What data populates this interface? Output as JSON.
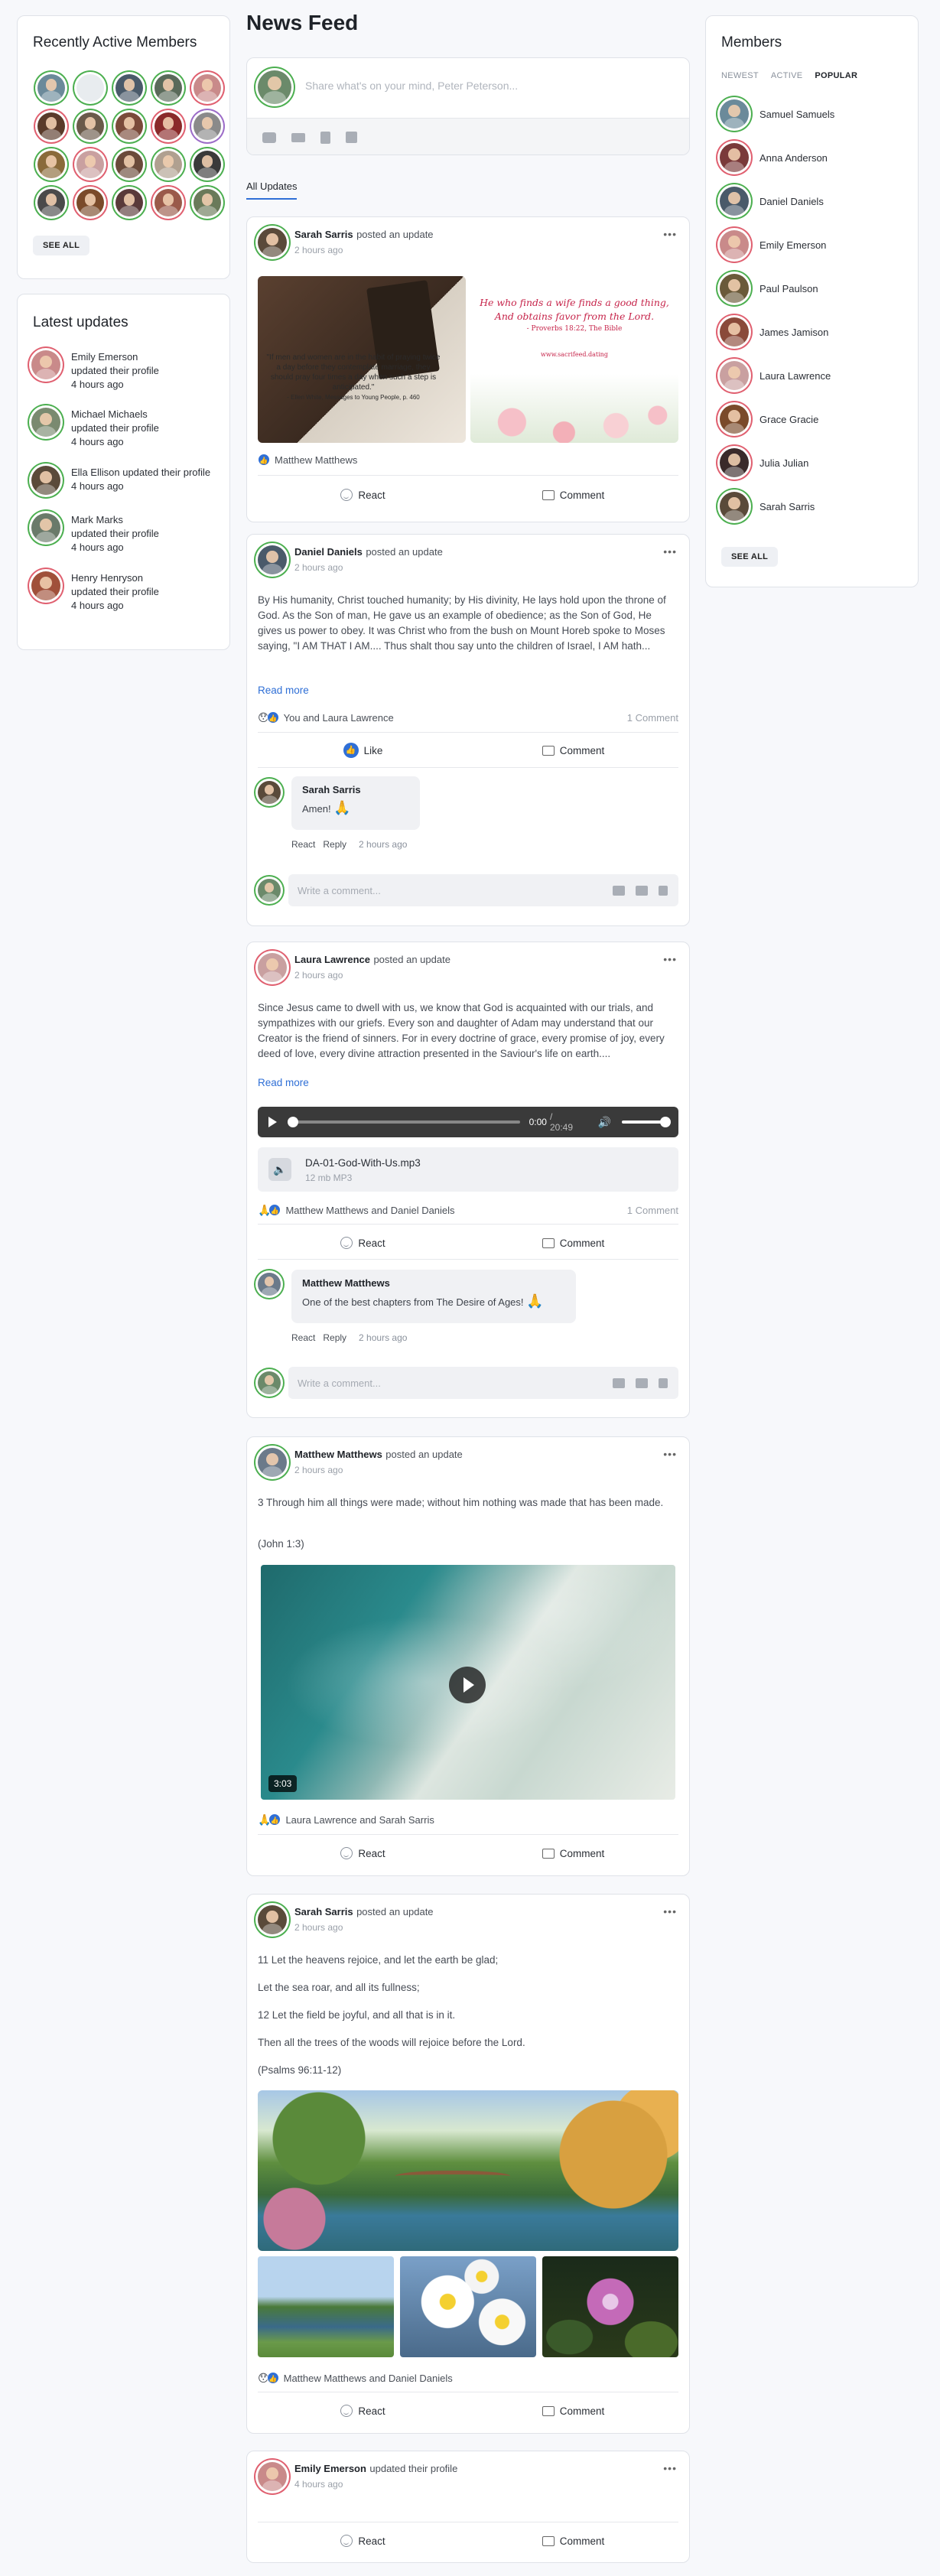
{
  "left": {
    "recent_title": "Recently Active Members",
    "see_all": "SEE ALL",
    "latest_title": "Latest updates",
    "updates": [
      {
        "name": "Emily Emerson",
        "action": "updated their profile",
        "time": "4 hours ago",
        "color": "#c98a8a"
      },
      {
        "name": "Michael Michaels",
        "action": "updated their profile",
        "time": "4 hours ago",
        "color": "#7a8a70"
      },
      {
        "name": "Ella Ellison",
        "action": "updated their profile",
        "time": "4 hours ago",
        "color": "#5a4a3a"
      },
      {
        "name": "Mark Marks",
        "action": "updated their profile",
        "time": "4 hours ago",
        "color": "#6a7a6a"
      },
      {
        "name": "Henry Henryson",
        "action": "updated their profile",
        "time": "4 hours ago",
        "color": "#a0503a"
      }
    ]
  },
  "feed": {
    "title": "News Feed",
    "composer_placeholder": "Share what's on your mind, Peter Peterson...",
    "tab_all": "All Updates",
    "react": "React",
    "comment": "Comment",
    "like": "Like",
    "read_more": "Read more",
    "write_comment": "Write a comment...",
    "reply": "Reply",
    "posts": [
      {
        "name": "Sarah Sarris",
        "action": "posted an update",
        "time": "2 hours ago",
        "image_quote": "\"If men and women are in the habit of praying twice a day before they contemplate marriage, they should pray four times a day when such a step is anticipated.\"",
        "image_credit": "- Ellen White, Messages to Young People, p. 460",
        "verse_line1": "He who finds a wife finds a good thing,",
        "verse_line2": "And obtains favor from the Lord.",
        "verse_ref": "- Proverbs 18:22, The Bible",
        "verse_site": "www.sacrifeed.dating",
        "reactions": "Matthew Matthews"
      },
      {
        "name": "Daniel Daniels",
        "action": "posted an update",
        "time": "2 hours ago",
        "text": "By His humanity, Christ touched humanity; by His divinity, He lays hold upon the throne of God. As the Son of man, He gave us an example of obedience; as the Son of God, He gives us power to obey. It was Christ who from the bush on Mount Horeb spoke to Moses saying, \"I AM THAT I AM.... Thus shalt thou say unto the children of Israel, I AM hath...",
        "reactions": "You and Laura Lawrence",
        "comment_count": "1 Comment",
        "c_name": "Sarah Sarris",
        "c_text": "Amen!",
        "c_time": "2 hours ago"
      },
      {
        "name": "Laura Lawrence",
        "action": "posted an update",
        "time": "2 hours ago",
        "text": "Since Jesus came to dwell with us, we know that God is acquainted with our trials, and sympathizes with our griefs. Every son and daughter of Adam may understand that our Creator is the friend of sinners. For in every doctrine of grace, every promise of joy, every deed of love, every divine attraction presented in the Saviour's life on earth....",
        "audio_cur": "0:00",
        "audio_dur": "/ 20:49",
        "file_name": "DA-01-God-With-Us.mp3",
        "file_meta": "12 mb  MP3",
        "reactions": "Matthew Matthews and Daniel Daniels",
        "comment_count": "1 Comment",
        "c_name": "Matthew Matthews",
        "c_text": "One of the best chapters from The Desire of Ages!",
        "c_time": "2 hours ago"
      },
      {
        "name": "Matthew Matthews",
        "action": "posted an update",
        "time": "2 hours ago",
        "text": "3 Through him all things were made; without him nothing was made that has been made.",
        "ref": "(John 1:3)",
        "video_time": "3:03",
        "reactions": "Laura Lawrence and Sarah Sarris"
      },
      {
        "name": "Sarah Sarris",
        "action": "posted an update",
        "time": "2 hours ago",
        "l1": "11 Let the heavens rejoice, and let the earth be glad;",
        "l2": "Let the sea roar, and all its fullness;",
        "l3": "12 Let the field be joyful, and all that is in it.",
        "l4": "Then all the trees of the woods will rejoice before the Lord.",
        "ref": "(Psalms 96:11-12)",
        "reactions": "Matthew Matthews and Daniel Daniels"
      },
      {
        "name": "Emily Emerson",
        "action": "updated their profile",
        "time": "4 hours ago"
      }
    ]
  },
  "right": {
    "title": "Members",
    "tabs": [
      "NEWEST",
      "ACTIVE",
      "POPULAR"
    ],
    "members": [
      {
        "name": "Samuel Samuels",
        "color": "#6b8a9a"
      },
      {
        "name": "Anna Anderson",
        "color": "#7a3a3a"
      },
      {
        "name": "Daniel Daniels",
        "color": "#4a5a6a"
      },
      {
        "name": "Emily Emerson",
        "color": "#c98a8a"
      },
      {
        "name": "Paul Paulson",
        "color": "#6a5a3a"
      },
      {
        "name": "James Jamison",
        "color": "#8a4a3a"
      },
      {
        "name": "Laura Lawrence",
        "color": "#c9a0a0"
      },
      {
        "name": "Grace Gracie",
        "color": "#7a4a2a"
      },
      {
        "name": "Julia Julian",
        "color": "#3a2a2a"
      },
      {
        "name": "Sarah Sarris",
        "color": "#5a4a3a"
      }
    ],
    "see_all": "SEE ALL"
  }
}
